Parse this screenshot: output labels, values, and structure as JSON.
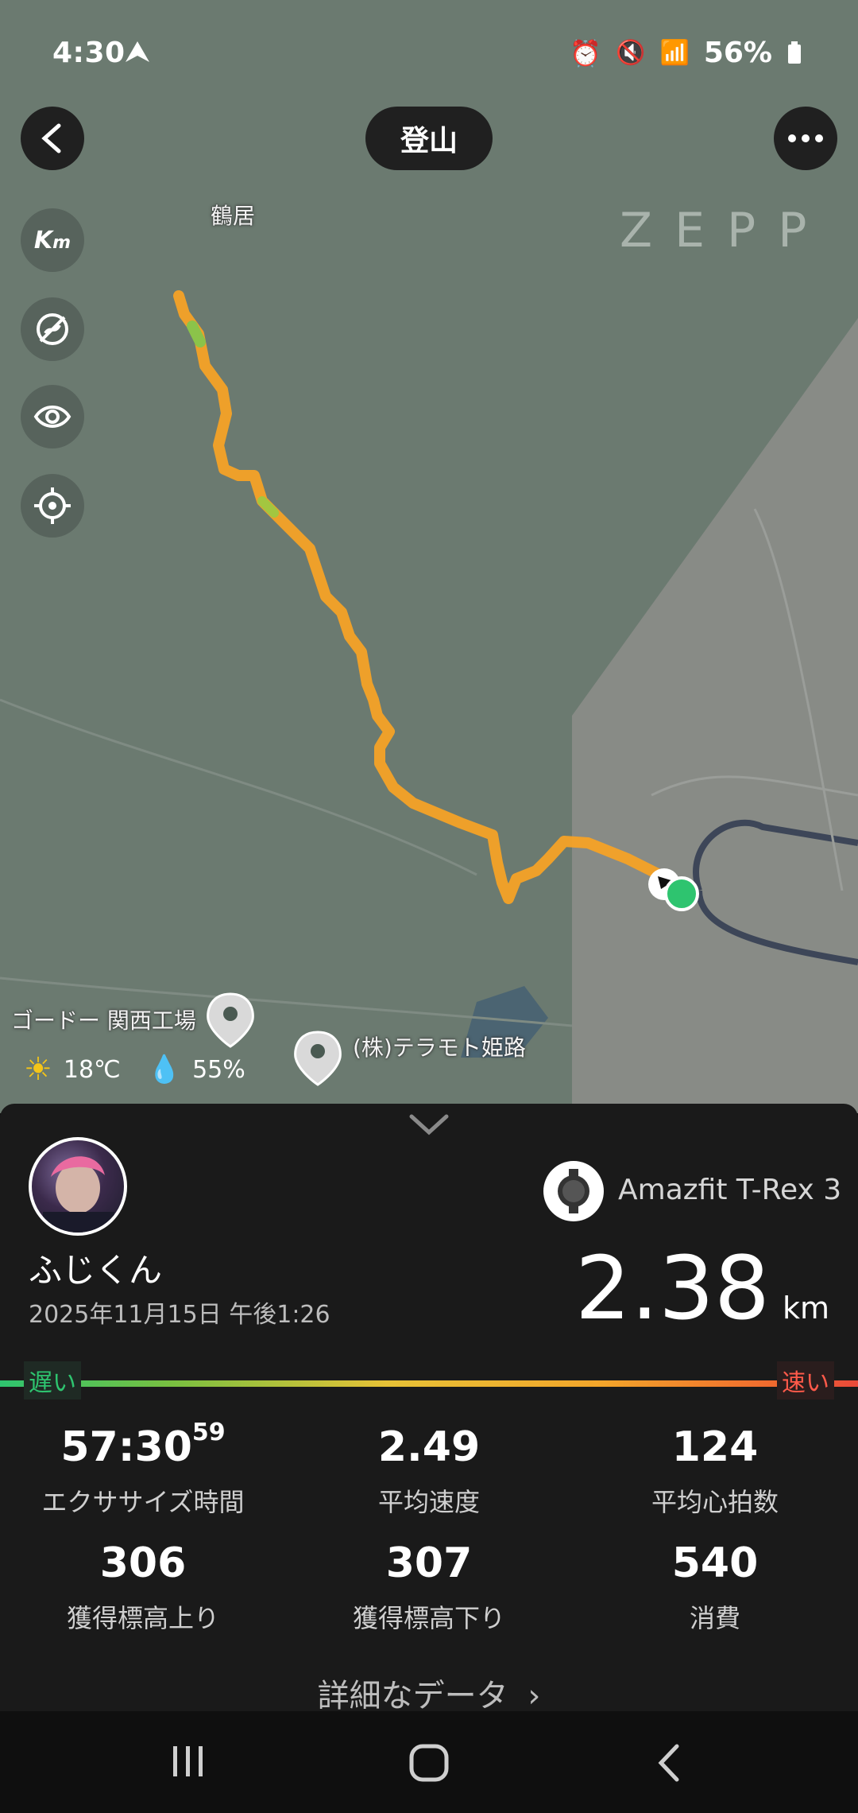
{
  "status_bar": {
    "time": "4:30",
    "battery_text": "56%"
  },
  "header": {
    "title": "登山"
  },
  "map": {
    "brand": "ZEPP",
    "labels": {
      "place_1": "鶴居",
      "poi_1": "ゴードー 関西工場",
      "poi_2": "(株)テラモト姫路"
    }
  },
  "weather": {
    "temperature": "18℃",
    "humidity": "55%"
  },
  "profile": {
    "name": "ふじくん",
    "date": "2025年11月15日 午後1:26"
  },
  "device": {
    "name": "Amazfit T-Rex 3"
  },
  "distance": {
    "value": "2.38",
    "unit": "km"
  },
  "pace_scale": {
    "slow": "遅い",
    "fast": "速い"
  },
  "stats": [
    {
      "value": "57:30",
      "sup": "59",
      "label": "エクササイズ時間"
    },
    {
      "value": "2.49",
      "label": "平均速度"
    },
    {
      "value": "124",
      "label": "平均心拍数"
    },
    {
      "value": "306",
      "label": "獲得標高上り"
    },
    {
      "value": "307",
      "label": "獲得標高下り"
    },
    {
      "value": "540",
      "label": "消費"
    }
  ],
  "more_link": "詳細なデータ",
  "colors": {
    "route_main": "#f4a52a",
    "route_green": "#8bc34a",
    "end_marker": "#2ec46f",
    "map_bg": "#6b7a70"
  }
}
